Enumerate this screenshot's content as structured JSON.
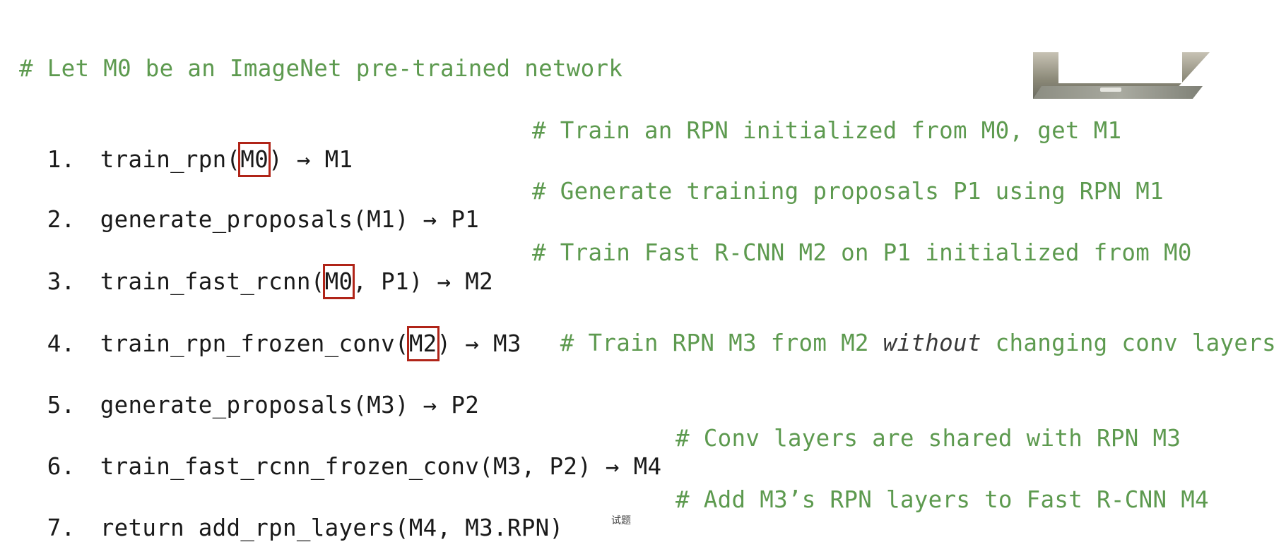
{
  "header_comment": "# Let M0 be an ImageNet pre-trained network",
  "lines": [
    {
      "num": "1.",
      "pre": "train_rpn(",
      "box": "M0",
      "post": ") → M1",
      "comment": "# Train an RPN initialized from M0, get M1"
    },
    {
      "num": "2.",
      "code": "generate_proposals(M1) → P1",
      "comment": "# Generate training proposals P1 using RPN M1"
    },
    {
      "num": "3.",
      "pre": "train_fast_rcnn(",
      "box": "M0",
      "post": ", P1) → M2",
      "comment": "# Train Fast R-CNN M2 on P1 initialized from M0"
    },
    {
      "num": "4.",
      "pre": "train_rpn_frozen_conv(",
      "box": "M2",
      "post": ") → M3",
      "comment_a": "# Train RPN M3 from M2 ",
      "comment_it": "without",
      "comment_b": " changing conv layers"
    },
    {
      "num": "5.",
      "code": "generate_proposals(M3) → P2"
    },
    {
      "num": "6.",
      "code": "train_fast_rcnn_frozen_conv(M3, P2) → M4",
      "comment": "# Conv layers are shared with RPN M3"
    },
    {
      "num": "7.",
      "code": "return add_rpn_layers(M4, M3.RPN)",
      "comment": "# Add M3’s RPN layers to Fast R-CNN M4"
    }
  ],
  "bottom_caption": "试题",
  "colors": {
    "code": "#1a1a1a",
    "comment": "#5d9a4f",
    "highlight_box": "#b02418"
  }
}
